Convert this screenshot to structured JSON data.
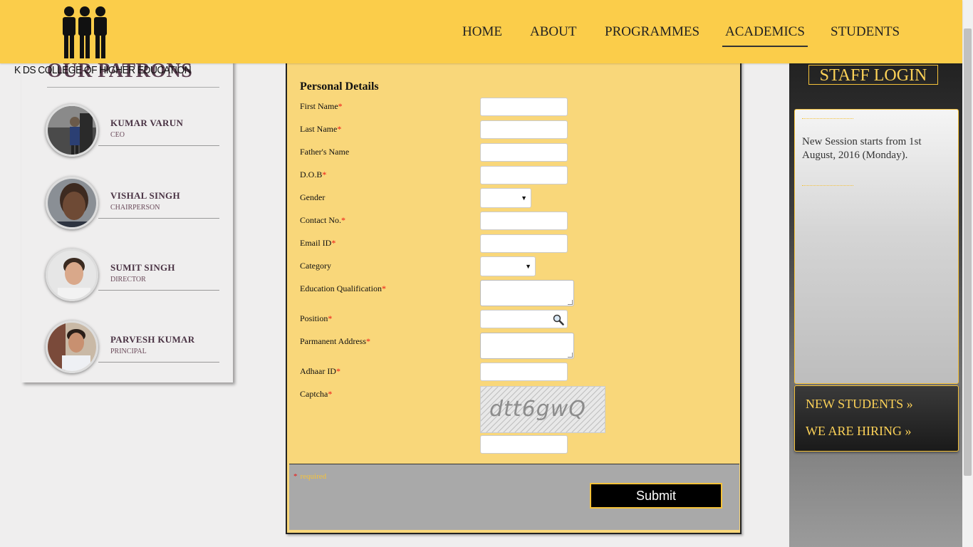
{
  "header": {
    "logo_text": "K DS COLLEGE OF HIGHER EDUCATION",
    "nav": [
      {
        "label": "HOME"
      },
      {
        "label": "ABOUT"
      },
      {
        "label": "PROGRAMMES"
      },
      {
        "label": "ACADEMICS",
        "active": true
      },
      {
        "label": "STUDENTS"
      }
    ]
  },
  "patrons": {
    "title": "OUR PATRONS",
    "items": [
      {
        "name": "KUMAR VARUN",
        "role": "CEO"
      },
      {
        "name": "VISHAL SINGH",
        "role": "CHAIRPERSON"
      },
      {
        "name": "SUMIT SINGH",
        "role": "DIRECTOR"
      },
      {
        "name": "PARVESH KUMAR",
        "role": "PRINCIPAL"
      }
    ]
  },
  "form": {
    "heading": "Personal Details",
    "fields": [
      {
        "label": "First Name",
        "required": "*"
      },
      {
        "label": "Last Name",
        "required": "*"
      },
      {
        "label": "Father's Name",
        "required": ""
      },
      {
        "label": "D.O.B",
        "required": "*"
      },
      {
        "label": "Gender",
        "required": ""
      },
      {
        "label": "Contact No.",
        "required": "*"
      },
      {
        "label": "Email ID",
        "required": "*"
      },
      {
        "label": "Category",
        "required": ""
      },
      {
        "label": "Education Qualification",
        "required": "*"
      },
      {
        "label": "Position",
        "required": "*"
      },
      {
        "label": "Parmanent Address",
        "required": "*"
      },
      {
        "label": "Adhaar ID",
        "required": "*"
      },
      {
        "label": "Captcha",
        "required": "*"
      }
    ],
    "captcha_text": "dtt6gwQ",
    "required_star": "*",
    "required_note": "required",
    "submit_label": "Submit"
  },
  "sidebar": {
    "staff_login": "STAFF LOGIN",
    "news": "New Session starts from 1st August, 2016 (Monday).",
    "links": [
      {
        "label": "NEW STUDENTS »"
      },
      {
        "label": "WE ARE HIRING »"
      }
    ]
  },
  "colors": {
    "header_bg": "#fbcd4a",
    "form_bg": "#f9d77a",
    "accent": "#f5c23a",
    "required": "#ee1111"
  }
}
